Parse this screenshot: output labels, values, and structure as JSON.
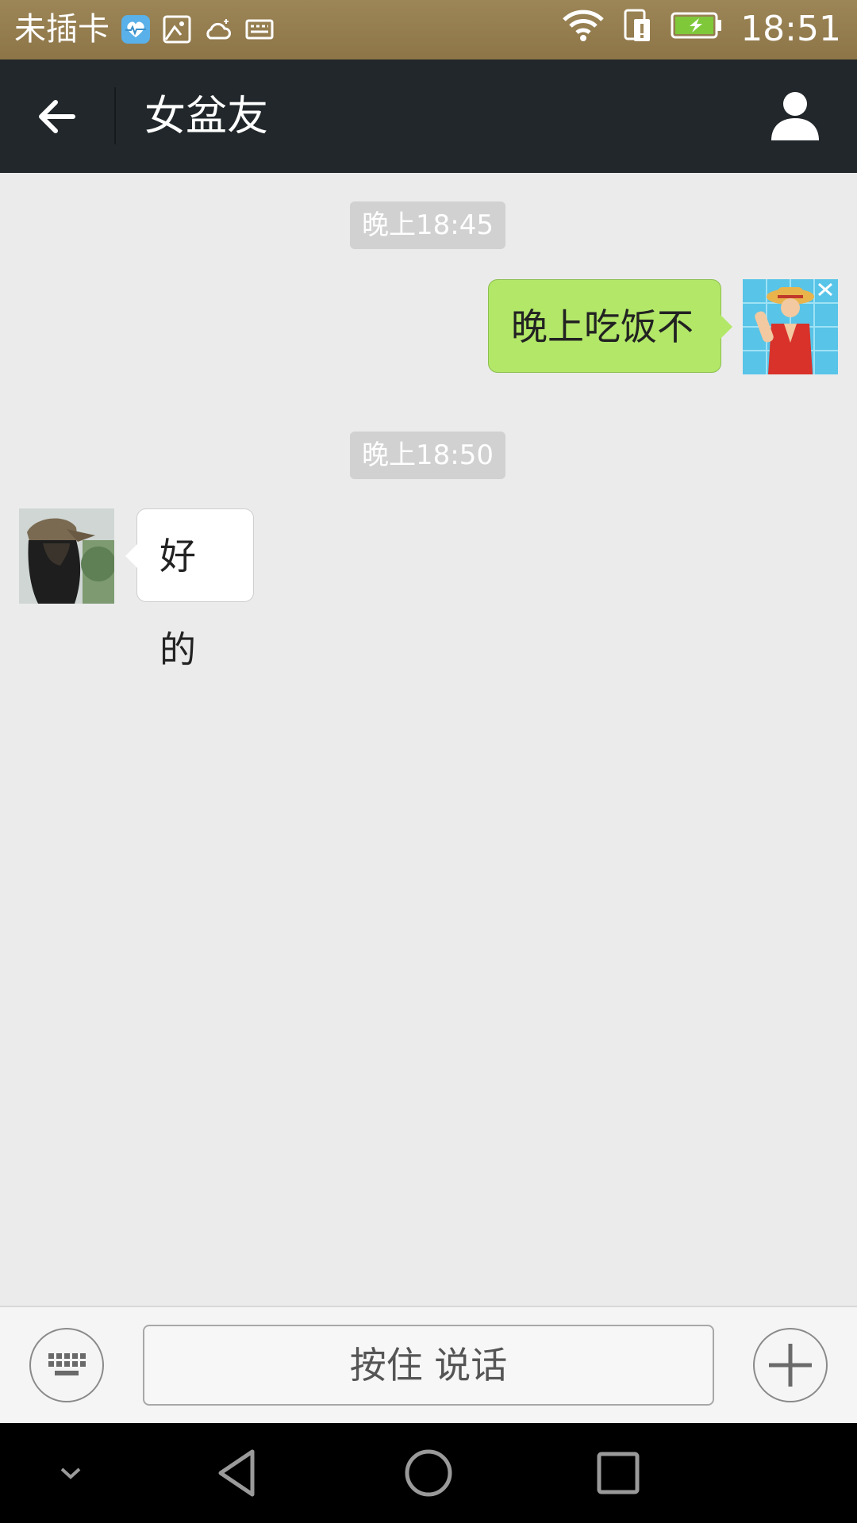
{
  "status_bar": {
    "carrier": "未插卡",
    "time": "18:51",
    "icons": [
      "health-app-icon",
      "image-icon",
      "cloud-icon",
      "keyboard-icon",
      "wifi-icon",
      "sim-icon",
      "battery-charging-icon"
    ],
    "battery_color": "#7ec83a"
  },
  "header": {
    "title": "女盆友",
    "back_icon": "back-arrow-icon",
    "profile_icon": "person-icon"
  },
  "messages": [
    {
      "type": "timestamp",
      "text": "晚上18:45"
    },
    {
      "type": "sent",
      "text": "晚上吃饭不",
      "avatar": "anime-avatar"
    },
    {
      "type": "timestamp",
      "text": "晚上18:50"
    },
    {
      "type": "received",
      "text": "好的",
      "avatar": "contact-avatar"
    }
  ],
  "input_bar": {
    "left_icon": "keyboard-icon",
    "hold_to_talk_label": "按住 说话",
    "right_icon": "plus-icon"
  },
  "nav_bar": {
    "icons": [
      "chevron-down-icon",
      "back-triangle-icon",
      "home-circle-icon",
      "recents-square-icon"
    ]
  },
  "colors": {
    "status_bar": "#8d7548",
    "header": "#21272a",
    "chat_bg": "#ebebeb",
    "sent_bubble": "#b2e768",
    "received_bubble": "#ffffff",
    "timestamp_chip": "#d1d1d1"
  }
}
